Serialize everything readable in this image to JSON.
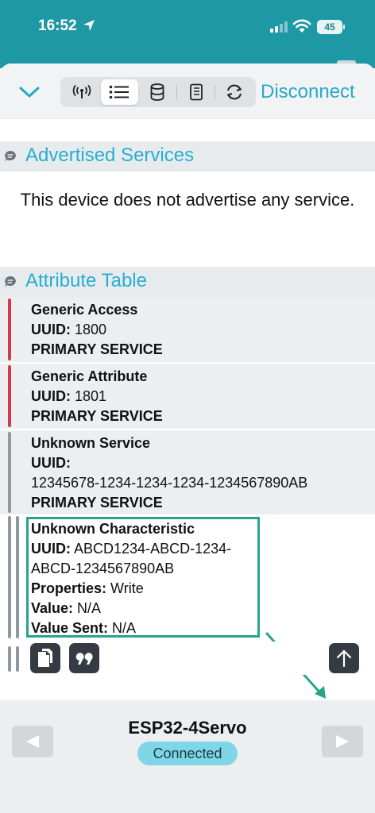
{
  "status_bar": {
    "time": "16:52",
    "battery": "45"
  },
  "toolbar": {
    "disconnect_label": "Disconnect",
    "tabs": [
      "antenna",
      "list",
      "database",
      "notebook",
      "refresh"
    ],
    "active_tab": "list"
  },
  "advertised": {
    "title": "Advertised Services",
    "message": "This device does not advertise any service."
  },
  "attributes": {
    "title": "Attribute Table",
    "services": [
      {
        "name": "Generic Access",
        "uuid_label": "UUID:",
        "uuid": "1800",
        "kind": "PRIMARY SERVICE"
      },
      {
        "name": "Generic Attribute",
        "uuid_label": "UUID:",
        "uuid": "1801",
        "kind": "PRIMARY SERVICE"
      },
      {
        "name": "Unknown Service",
        "uuid_label": "UUID:",
        "uuid": "12345678-1234-1234-1234-1234567890AB",
        "kind": "PRIMARY SERVICE"
      }
    ],
    "characteristic": {
      "name": "Unknown Characteristic",
      "uuid_label": "UUID:",
      "uuid_line1": "ABCD1234-ABCD-1234-",
      "uuid_line2": "ABCD-1234567890AB",
      "properties_label": "Properties:",
      "properties": "Write",
      "value_label": "Value:",
      "value": "N/A",
      "value_sent_label": "Value Sent:",
      "value_sent": "N/A"
    }
  },
  "footer": {
    "device_name": "ESP32-4Servo",
    "status": "Connected"
  },
  "colors": {
    "accent": "#26a9c9",
    "status_bar": "#1f98a6",
    "service_bar_red": "#d23a4b",
    "service_bar_gray": "#8f99a3",
    "highlight": "#2aa38a"
  }
}
